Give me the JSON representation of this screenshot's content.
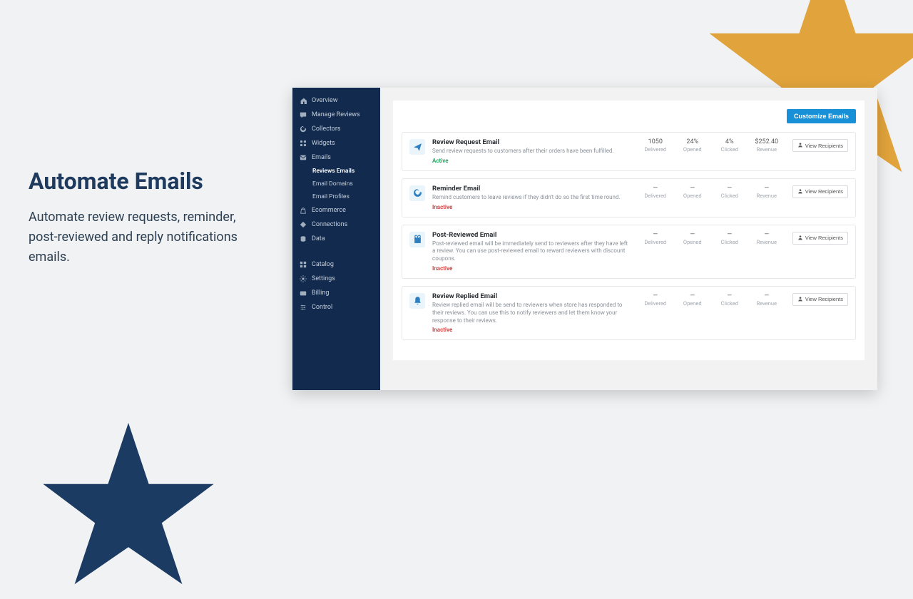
{
  "marketing": {
    "title": "Automate Emails",
    "body": "Automate review requests, reminder, post-reviewed and reply notifications emails."
  },
  "sidebar": {
    "items": [
      {
        "label": "Overview",
        "icon": "home"
      },
      {
        "label": "Manage Reviews",
        "icon": "review"
      },
      {
        "label": "Collectors",
        "icon": "refresh"
      },
      {
        "label": "Widgets",
        "icon": "widgets"
      },
      {
        "label": "Emails",
        "icon": "mail"
      }
    ],
    "sub": [
      {
        "label": "Reviews Emails",
        "active": true
      },
      {
        "label": "Email Domains"
      },
      {
        "label": "Email Profiles"
      }
    ],
    "items2": [
      {
        "label": "Ecommerce",
        "icon": "bag"
      },
      {
        "label": "Connections",
        "icon": "diamond"
      },
      {
        "label": "Data",
        "icon": "db"
      }
    ],
    "items3": [
      {
        "label": "Catalog",
        "icon": "grid"
      },
      {
        "label": "Settings",
        "icon": "gear"
      },
      {
        "label": "Billing",
        "icon": "card"
      },
      {
        "label": "Control",
        "icon": "sliders"
      }
    ]
  },
  "panel": {
    "customize_btn": "Customize Emails",
    "view_btn": "View Recipients",
    "stat_labels": [
      "Delivered",
      "Opened",
      "Clicked",
      "Revenue"
    ],
    "dash": "—",
    "cards": [
      {
        "icon": "send",
        "title": "Review Request Email",
        "desc": "Send review requests to customers after their orders have been fulfilled.",
        "status": "Active",
        "status_class": "active",
        "stats": [
          "1050",
          "24%",
          "4%",
          "$252.40"
        ]
      },
      {
        "icon": "refresh",
        "title": "Reminder Email",
        "desc": "Remind customers to leave reviews if they didn't do so the first time round.",
        "status": "Inactive",
        "status_class": "inactive",
        "stats": [
          "—",
          "—",
          "—",
          "—"
        ]
      },
      {
        "icon": "gift",
        "title": "Post-Reviewed Email",
        "desc": "Post-reviewed email will be immediately send to reviewers after they have left a review. You can use post-reviewed email to reward reviewers with discount coupons.",
        "status": "Inactive",
        "status_class": "inactive",
        "stats": [
          "—",
          "—",
          "—",
          "—"
        ]
      },
      {
        "icon": "bell",
        "title": "Review Replied Email",
        "desc": "Review replied email will be send to reviewers when store has responded to their reviews. You can use this to notify reviewers and let them know your response to their reviews.",
        "status": "Inactive",
        "status_class": "inactive",
        "stats": [
          "—",
          "—",
          "—",
          "—"
        ]
      }
    ]
  },
  "colors": {
    "star_gold": "#e1a33b",
    "star_navy": "#1c3b63"
  }
}
